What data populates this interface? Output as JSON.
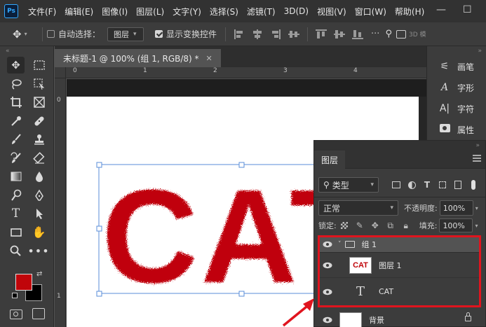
{
  "menubar": {
    "logo": "Ps",
    "items": [
      "文件(F)",
      "编辑(E)",
      "图像(I)",
      "图层(L)",
      "文字(Y)",
      "选择(S)",
      "滤镜(T)",
      "3D(D)",
      "视图(V)",
      "窗口(W)",
      "帮助(H)"
    ],
    "minimize": "—",
    "maximize": "☐"
  },
  "options": {
    "auto_select_label": "自动选择：",
    "auto_select_target": "图层",
    "show_transform_label": "显示变换控件",
    "mode_3d": "3D 模"
  },
  "document": {
    "tab_title": "未标题-1 @ 100% (组 1, RGB/8) *",
    "close": "✕"
  },
  "ruler": {
    "top_labels": [
      "0",
      "1",
      "2",
      "3",
      "4"
    ],
    "left_labels": [
      "0",
      "1"
    ]
  },
  "canvas": {
    "art_text": "CAT",
    "art_color": "#c0050a"
  },
  "side_panel": {
    "items": [
      {
        "label": "画笔",
        "icon": "brush-settings-icon"
      },
      {
        "label": "字形",
        "icon": "glyphs-icon"
      },
      {
        "label": "字符",
        "icon": "character-icon"
      },
      {
        "label": "属性",
        "icon": "properties-icon"
      }
    ]
  },
  "layers_panel": {
    "tab": "图层",
    "filter_kind": "类型",
    "blend_mode": "正常",
    "opacity_label": "不透明度:",
    "opacity_value": "100%",
    "lock_label": "锁定:",
    "fill_label": "填充:",
    "fill_value": "100%",
    "layers": [
      {
        "name": "组 1",
        "type": "group",
        "visible": true
      },
      {
        "name": "图层 1",
        "type": "pixel",
        "visible": true,
        "thumb_text": "CAT"
      },
      {
        "name": "CAT",
        "type": "text",
        "visible": true
      },
      {
        "name": "背景",
        "type": "background",
        "visible": true,
        "locked": true
      }
    ]
  },
  "colors": {
    "foreground": "#c0050a",
    "background": "#000000",
    "highlight": "#e0141e",
    "accent": "#31a8ff"
  }
}
